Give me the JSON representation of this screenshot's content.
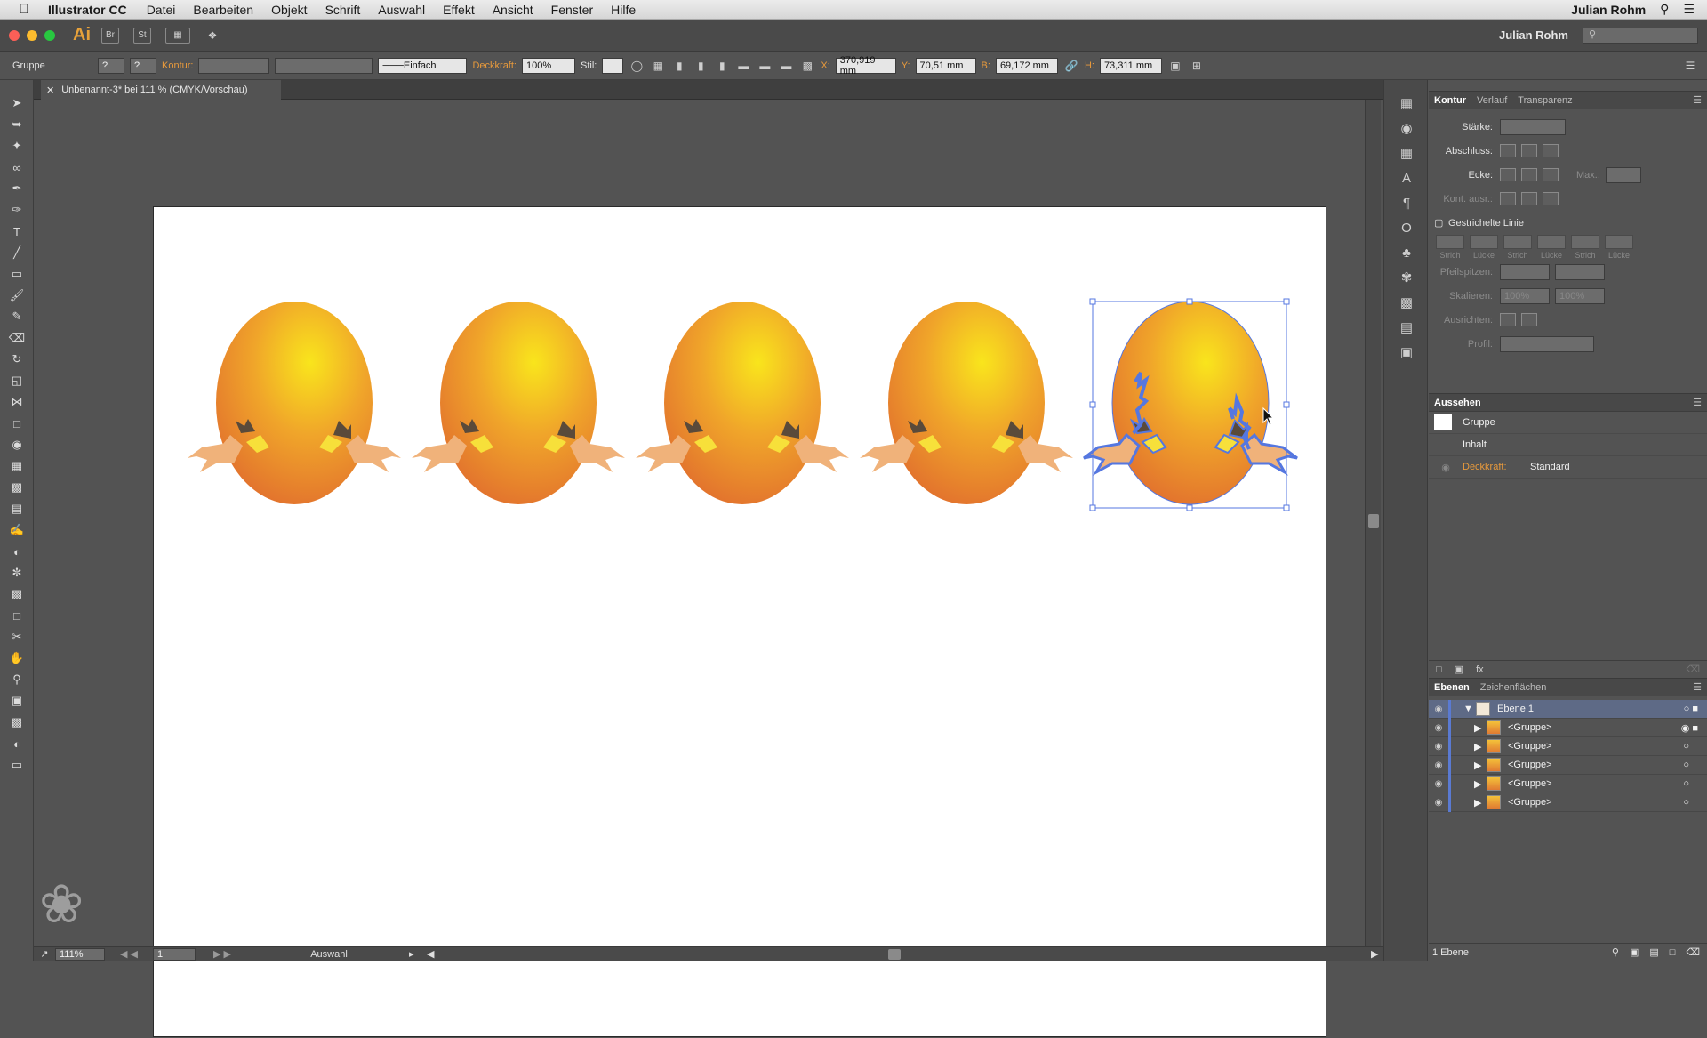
{
  "menubar": {
    "app_name": "Illustrator CC",
    "items": [
      "Datei",
      "Bearbeiten",
      "Objekt",
      "Schrift",
      "Auswahl",
      "Effekt",
      "Ansicht",
      "Fenster",
      "Hilfe"
    ],
    "user": "Julian Rohm"
  },
  "appbar": {
    "logo": "Ai",
    "br": "Br",
    "st": "St",
    "user_dropdown": "Julian Rohm"
  },
  "control": {
    "selection_label": "Gruppe",
    "kontur_label": "Kontur:",
    "stroke_style": "Einfach",
    "opacity_label": "Deckkraft:",
    "opacity_value": "100%",
    "style_label": "Stil:",
    "x_label": "X:",
    "x_value": "370,919 mm",
    "y_label": "Y:",
    "y_value": "70,51 mm",
    "b_label": "B:",
    "b_value": "69,172 mm",
    "h_label": "H:",
    "h_value": "73,311 mm"
  },
  "document": {
    "tab_title": "Unbenannt-3* bei 111 % (CMYK/Vorschau)"
  },
  "stroke_panel": {
    "tabs": [
      "Kontur",
      "Verlauf",
      "Transparenz"
    ],
    "staerke": "Stärke:",
    "abschluss": "Abschluss:",
    "ecke": "Ecke:",
    "max": "Max.:",
    "kont_ausr": "Kont. ausr.:",
    "dashed_title": "Gestrichelte Linie",
    "dash_labels": [
      "Strich",
      "Lücke",
      "Strich",
      "Lücke",
      "Strich",
      "Lücke"
    ],
    "pfeilspitzen": "Pfeilspitzen:",
    "skalieren": "Skalieren:",
    "skal_value_1": "100%",
    "skal_value_2": "100%",
    "ausrichten": "Ausrichten:",
    "profil": "Profil:"
  },
  "appearance_panel": {
    "title": "Aussehen",
    "group": "Gruppe",
    "content": "Inhalt",
    "opacity_label": "Deckkraft:",
    "opacity_value": "Standard"
  },
  "layers_panel": {
    "tabs": [
      "Ebenen",
      "Zeichenflächen"
    ],
    "layer_name": "Ebene 1",
    "groups": [
      "<Gruppe>",
      "<Gruppe>",
      "<Gruppe>",
      "<Gruppe>",
      "<Gruppe>"
    ],
    "footer": "1 Ebene"
  },
  "status": {
    "zoom": "111%",
    "artboard_number": "1",
    "tool_info": "Auswahl"
  },
  "colors": {
    "accent_orange": "#e89a3c",
    "selection_blue": "#5577e0",
    "egg_top": "#f9e51c",
    "egg_bottom": "#e06a2e"
  }
}
